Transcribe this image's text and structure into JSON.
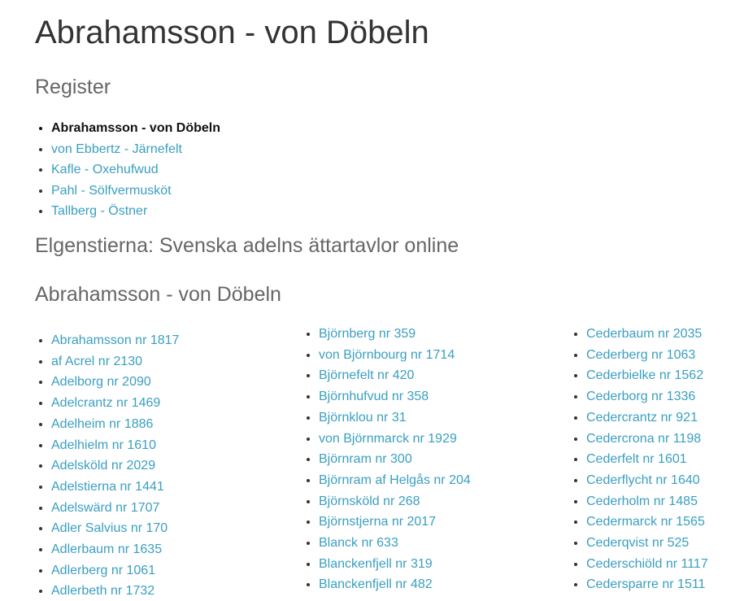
{
  "title": "Abrahamsson - von Döbeln",
  "register": {
    "heading": "Register",
    "items": [
      {
        "label": "Abrahamsson - von Döbeln",
        "current": true
      },
      {
        "label": "von Ebbertz - Järnefelt",
        "current": false
      },
      {
        "label": "Kafle - Oxehufwud",
        "current": false
      },
      {
        "label": "Pahl - Sölfvermusköt",
        "current": false
      },
      {
        "label": "Tallberg - Östner",
        "current": false
      }
    ]
  },
  "site_heading": "Elgenstierna: Svenska adelns ättartavlor online",
  "section_heading": "Abrahamsson - von Döbeln",
  "columns": [
    [
      "Abrahamsson nr 1817",
      "af Acrel nr 2130",
      "Adelborg nr 2090",
      "Adelcrantz nr 1469",
      "Adelheim nr 1886",
      "Adelhielm nr 1610",
      "Adelsköld nr 2029",
      "Adelstierna nr 1441",
      "Adelswärd nr 1707",
      "Adler Salvius nr 170",
      "Adlerbaum nr 1635",
      "Adlerberg nr 1061",
      "Adlerbeth nr 1732"
    ],
    [
      "Björnberg nr 359",
      "von Björnbourg nr 1714",
      "Björnefelt nr 420",
      "Björnhufvud nr 358",
      "Björnklou nr 31",
      "von Björnmarck nr 1929",
      "Björnram nr 300",
      "Björnram af Helgås nr 204",
      "Björnsköld nr 268",
      "Björnstjerna nr 2017",
      "Blanck nr 633",
      "Blanckenfjell nr 319",
      "Blanckenfjell nr 482"
    ],
    [
      "Cederbaum nr 2035",
      "Cederberg nr 1063",
      "Cederbielke nr 1562",
      "Cederborg nr 1336",
      "Cedercrantz nr 921",
      "Cedercrona nr 1198",
      "Cederfelt nr 1601",
      "Cederflycht nr 1640",
      "Cederholm nr 1485",
      "Cedermarck nr 1565",
      "Cederqvist nr 525",
      "Cederschiöld nr 1117",
      "Cedersparre nr 1511"
    ]
  ],
  "colors": {
    "link": "#3a9fc1",
    "heading": "#666666",
    "text": "#333333"
  }
}
